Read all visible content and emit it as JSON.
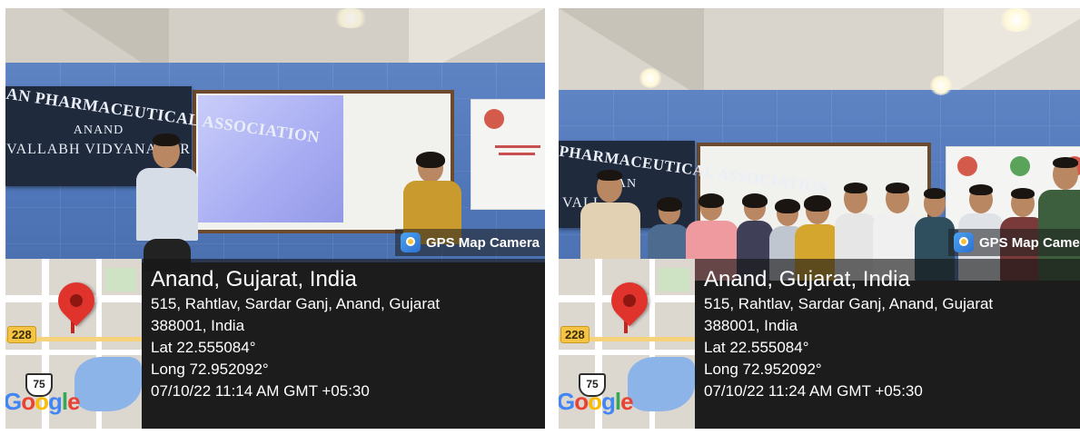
{
  "photos": [
    {
      "id": "photo-1",
      "banner": {
        "line1": "AN PHARMACEUTICAL ASSOCIATION",
        "line2": "ANAND",
        "line3": "VALLABH VIDYANAGAR"
      },
      "badge": "GPS Map Camera",
      "place": "Anand, Gujarat, India",
      "address_line1": "515, Rahtlav, Sardar Ganj, Anand, Gujarat",
      "address_line2": "388001, India",
      "lat": "Lat 22.555084°",
      "long": "Long 72.952092°",
      "datetime": "07/10/22 11:14 AM GMT +05:30",
      "map": {
        "shield_1": "228",
        "shield_2": "75",
        "logo": [
          "G",
          "o",
          "o",
          "g",
          "l",
          "e"
        ]
      }
    },
    {
      "id": "photo-2",
      "banner": {
        "line1": "PHARMACEUTICAL ASSOCIATION",
        "line2": "AN",
        "line3": "VALL"
      },
      "badge": "GPS Map Camera",
      "place": "Anand, Gujarat, India",
      "address_line1": "515, Rahtlav, Sardar Ganj, Anand, Gujarat",
      "address_line2": "388001, India",
      "lat": "Lat 22.555084°",
      "long": "Long 72.952092°",
      "datetime": "07/10/22 11:24 AM GMT +05:30",
      "map": {
        "shield_1": "228",
        "shield_2": "75",
        "logo": [
          "G",
          "o",
          "o",
          "g",
          "l",
          "e"
        ]
      }
    }
  ],
  "colors": {
    "wall": "#5f84c4",
    "banner": "#1f2a3c",
    "pin": "#e0332c",
    "overlay": "#141414"
  }
}
